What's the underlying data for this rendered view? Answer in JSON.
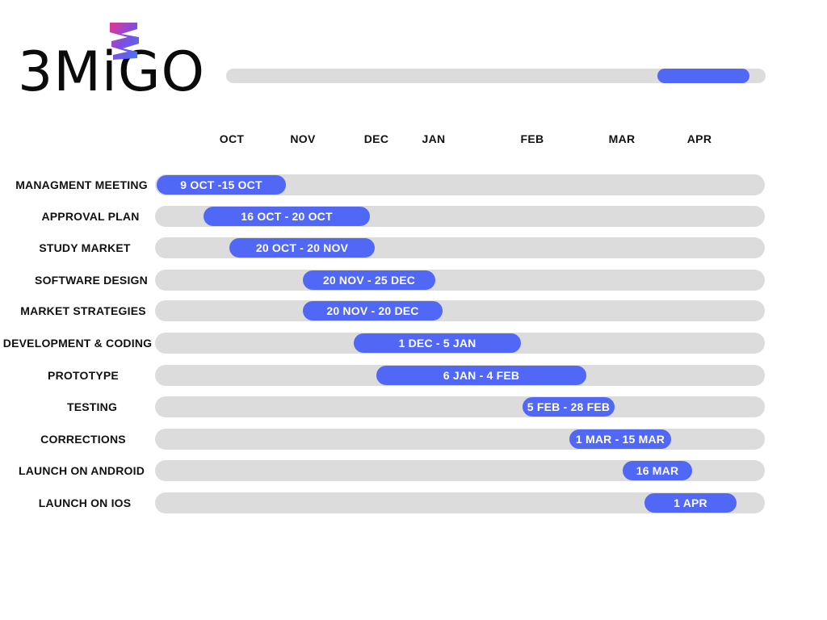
{
  "brand": {
    "logo_text": "3MiGO",
    "accent_color": "#5167f5",
    "track_color": "#dcdcdc",
    "logo_gradient": [
      "#e8348f",
      "#7b4fe3",
      "#3f7bf5"
    ]
  },
  "progress": {
    "start_fraction": 0.8,
    "end_fraction": 0.97
  },
  "months": [
    "OCT",
    "NOV",
    "DEC",
    "JAN",
    "FEB",
    "MAR",
    "APR"
  ],
  "chart_data": {
    "type": "gantt",
    "title": "",
    "x_axis": [
      "OCT",
      "NOV",
      "DEC",
      "JAN",
      "FEB",
      "MAR",
      "APR"
    ],
    "tasks": [
      {
        "name": "MANAGMENT MEETING",
        "label": "9 OCT -15 OCT",
        "start": "2023-10-09",
        "end": "2023-10-15"
      },
      {
        "name": "APPROVAL PLAN",
        "label": "16 OCT - 20 OCT",
        "start": "2023-10-16",
        "end": "2023-10-20"
      },
      {
        "name": "STUDY MARKET",
        "label": "20 OCT - 20 NOV",
        "start": "2023-10-20",
        "end": "2023-11-20"
      },
      {
        "name": "SOFTWARE DESIGN",
        "label": "20 NOV - 25 DEC",
        "start": "2023-11-20",
        "end": "2023-12-25"
      },
      {
        "name": "MARKET STRATEGIES",
        "label": "20 NOV - 20 DEC",
        "start": "2023-11-20",
        "end": "2023-12-20"
      },
      {
        "name": "DEVELOPMENT & CODING",
        "label": "1 DEC - 5 JAN",
        "start": "2023-12-01",
        "end": "2024-01-05"
      },
      {
        "name": "PROTOTYPE",
        "label": "6 JAN - 4 FEB",
        "start": "2024-01-06",
        "end": "2024-02-04"
      },
      {
        "name": "TESTING",
        "label": "5 FEB - 28 FEB",
        "start": "2024-02-05",
        "end": "2024-02-28"
      },
      {
        "name": "CORRECTIONS",
        "label": "1 MAR - 15 MAR",
        "start": "2024-03-01",
        "end": "2024-03-15"
      },
      {
        "name": "LAUNCH ON ANDROID",
        "label": "16 MAR",
        "start": "2024-03-16",
        "end": "2024-03-16"
      },
      {
        "name": "LAUNCH ON IOS",
        "label": "1 APR",
        "start": "2024-04-01",
        "end": "2024-04-01"
      }
    ]
  }
}
